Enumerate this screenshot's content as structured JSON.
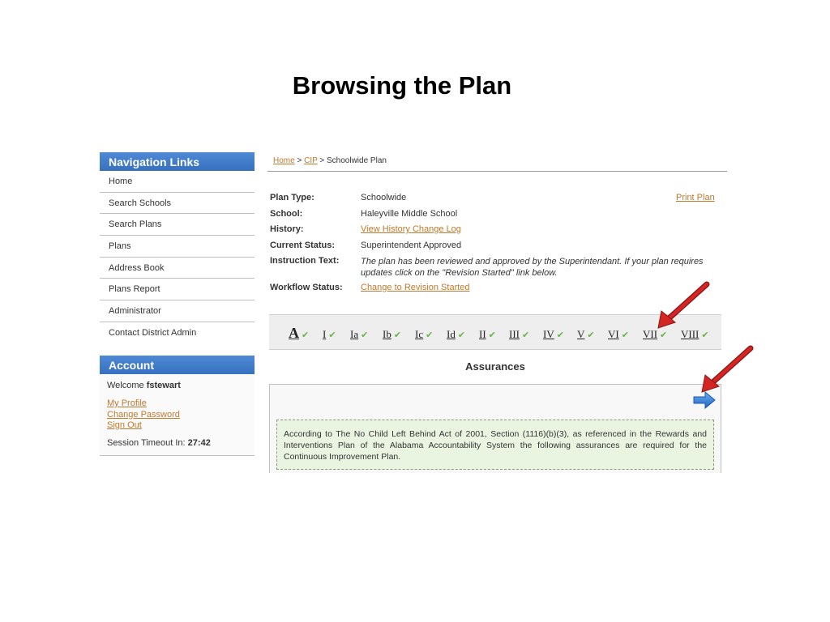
{
  "slide": {
    "title": "Browsing the Plan"
  },
  "nav": {
    "header": "Navigation Links",
    "items": [
      "Home",
      "Search Schools",
      "Search Plans",
      "Plans",
      "Address Book",
      "Plans Report",
      "Administrator",
      "Contact District Admin"
    ]
  },
  "account": {
    "header": "Account",
    "welcome_prefix": "Welcome ",
    "username": "fstewart",
    "links": [
      "My Profile",
      "Change Password",
      "Sign Out"
    ],
    "session_label": "Session Timeout In: ",
    "session_time": "27:42"
  },
  "breadcrumb": {
    "home": "Home",
    "sep1": " > ",
    "cip": "CIP",
    "sep2": " > ",
    "current": "Schoolwide Plan"
  },
  "plan": {
    "print_plan": "Print Plan",
    "rows": [
      {
        "label": "Plan Type:",
        "value": "Schoolwide"
      },
      {
        "label": "School:",
        "value": "Haleyville Middle School"
      },
      {
        "label": "History:",
        "value": "View History Change Log"
      },
      {
        "label": "Current Status:",
        "value": "Superintendent Approved"
      },
      {
        "label": "Instruction Text:",
        "value": "The plan has been reviewed and approved by the Superintendant. If your plan requires updates click on the \"Revision Started\" link below."
      },
      {
        "label": "Workflow Status:",
        "value": "Change to Revision Started"
      }
    ]
  },
  "sections": {
    "items": [
      "A",
      "I",
      "Ia",
      "Ib",
      "Ic",
      "Id",
      "II",
      "III",
      "IV",
      "V",
      "VI",
      "VII",
      "VIII"
    ],
    "check_glyph": "✔",
    "check_color": "#66b547"
  },
  "assurances": {
    "title": "Assurances",
    "note": "According to The No Child Left Behind Act of 2001, Section (1116)(b)(3), as referenced in the Rewards and Interventions Plan of the Alabama Accountability System the following assurances are required for the Continuous Improvement Plan."
  },
  "colors": {
    "nav_header": "#3d7cc9",
    "link": "#c0782c",
    "note_bg": "#eaf5e1",
    "annotation_arrow": "#cc1f1f"
  }
}
